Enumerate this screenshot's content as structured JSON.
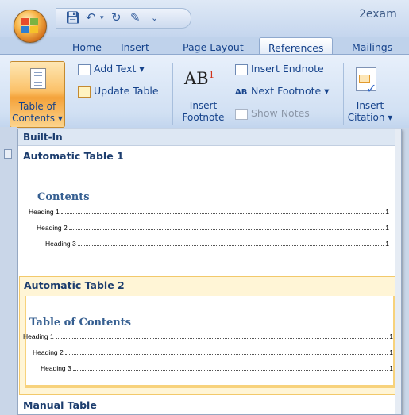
{
  "window": {
    "title_partial": "2exam"
  },
  "quick_access": {
    "icons": [
      "save-icon",
      "undo-icon",
      "redo-icon",
      "spellcheck-icon",
      "customize-icon"
    ]
  },
  "tabs": [
    {
      "label": "Home",
      "active": false
    },
    {
      "label": "Insert",
      "active": false
    },
    {
      "label": "Page Layout",
      "active": false
    },
    {
      "label": "References",
      "active": true
    },
    {
      "label": "Mailings",
      "active": false
    }
  ],
  "ribbon": {
    "toc": {
      "label_line1": "Table of",
      "label_line2": "Contents ▾"
    },
    "add_text": "Add Text ▾",
    "update_table": "Update Table",
    "insert_footnote": {
      "line1": "Insert",
      "line2": "Footnote"
    },
    "insert_endnote": "Insert Endnote",
    "next_footnote": "Next Footnote ▾",
    "show_notes": "Show Notes",
    "insert_citation": {
      "line1": "Insert",
      "line2": "Citation ▾"
    },
    "footnote_glyph": "AB",
    "footnote_sup": "1"
  },
  "gallery": {
    "section": "Built-In",
    "items": [
      {
        "title": "Automatic Table 1",
        "heading": "Contents",
        "rows": [
          {
            "text": "Heading 1",
            "page": "1",
            "level": 1
          },
          {
            "text": "Heading 2",
            "page": "1",
            "level": 2
          },
          {
            "text": "Heading 3",
            "page": "1",
            "level": 3
          }
        ]
      },
      {
        "title": "Automatic Table 2",
        "heading": "Table of Contents",
        "rows": [
          {
            "text": "Heading 1",
            "page": "1",
            "level": 1
          },
          {
            "text": "Heading 2",
            "page": "1",
            "level": 2
          },
          {
            "text": "Heading 3",
            "page": "1",
            "level": 3
          }
        ]
      },
      {
        "title": "Manual Table"
      }
    ]
  },
  "colors": {
    "accent": "#15428b",
    "hover": "#fff5d6",
    "heading_blue": "#365f91"
  }
}
